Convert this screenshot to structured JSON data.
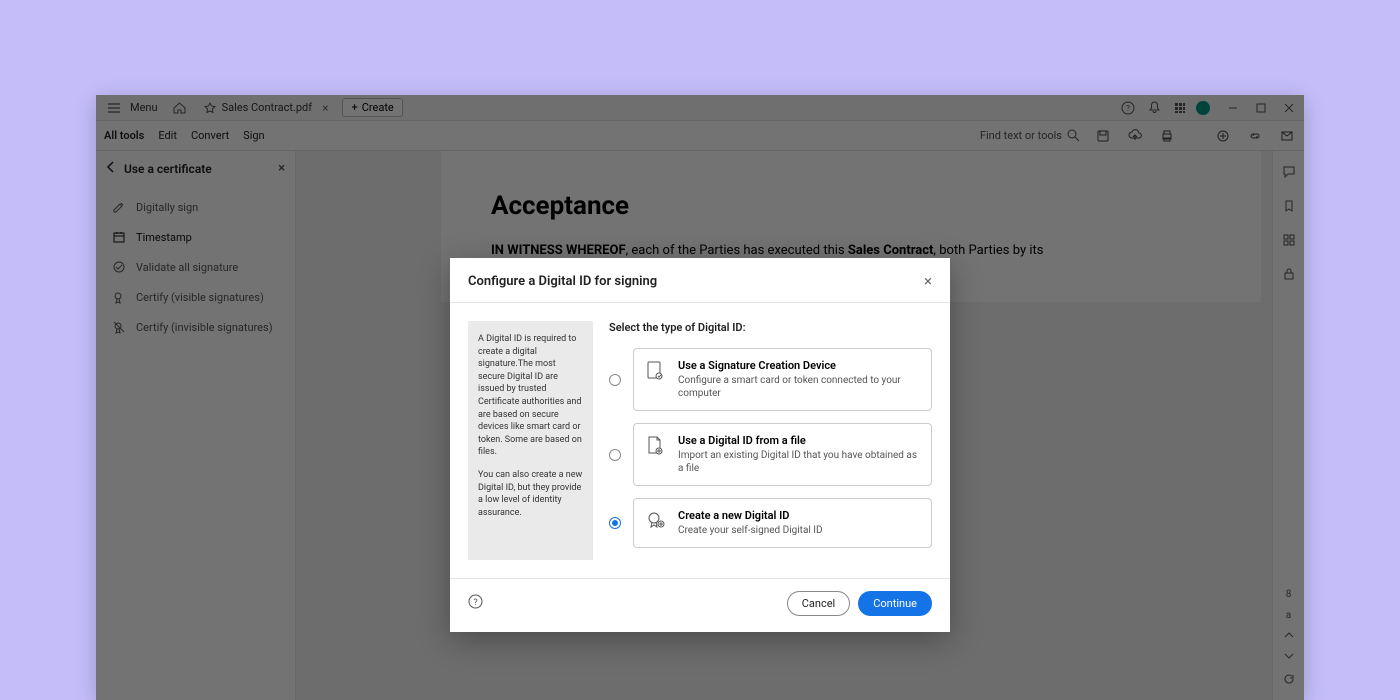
{
  "titlebar": {
    "menu_label": "Menu",
    "tab_name": "Sales Contract.pdf",
    "create_label": "Create"
  },
  "toolbar": {
    "all_tools": "All tools",
    "edit": "Edit",
    "convert": "Convert",
    "sign": "Sign",
    "search_placeholder": "Find text or tools"
  },
  "sidebar": {
    "title": "Use a certificate",
    "items": [
      {
        "label": "Digitally sign"
      },
      {
        "label": "Timestamp"
      },
      {
        "label": "Validate all signature"
      },
      {
        "label": "Certify (visible signatures)"
      },
      {
        "label": "Certify (invisible signatures)"
      }
    ]
  },
  "document": {
    "heading": "Acceptance",
    "witness_prefix": "IN WITNESS WHEREOF",
    "body_1": ", each of the Parties has executed this ",
    "contract_name": "Sales Contract",
    "body_2": ", both Parties by its"
  },
  "modal": {
    "title": "Configure a Digital ID for signing",
    "info_p1": "A Digital ID is required to create a digital signature.The most secure Digital ID are issued by trusted Certificate authorities and are based on secure devices like smart card or token. Some are based on files.",
    "info_p2": "You can also create a new Digital ID, but they provide a low level of identity assurance.",
    "select_prompt": "Select the type of Digital ID:",
    "options": [
      {
        "title": "Use a Signature Creation Device",
        "desc": "Configure a smart card or token connected to your computer"
      },
      {
        "title": "Use a Digital ID from a file",
        "desc": "Import an existing Digital ID that you have obtained as a file"
      },
      {
        "title": "Create a new Digital ID",
        "desc": "Create your self-signed Digital ID"
      }
    ],
    "cancel_label": "Cancel",
    "continue_label": "Continue"
  },
  "right_rail": {
    "page_num": "8",
    "total_char": "a"
  }
}
